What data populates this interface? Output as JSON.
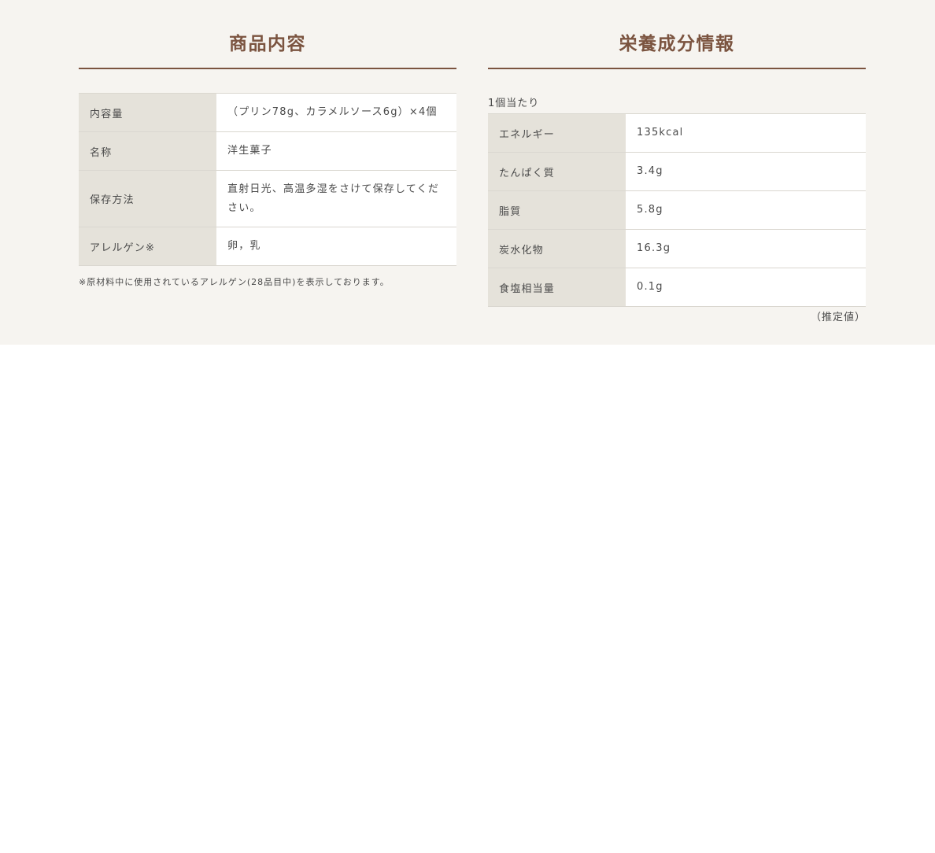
{
  "product": {
    "title": "商品内容",
    "rows": [
      {
        "label": "内容量",
        "value": "（プリン78g、カラメルソース6g）×4個"
      },
      {
        "label": "名称",
        "value": "洋生菓子"
      },
      {
        "label": "保存方法",
        "value": "直射日光、高温多湿をさけて保存してください。"
      },
      {
        "label": "アレルゲン※",
        "value": "卵，乳"
      }
    ],
    "note": "※原材料中に使用されているアレルゲン(28品目中)を表示しております。"
  },
  "nutrition": {
    "title": "栄養成分情報",
    "per_unit": "1個当たり",
    "rows": [
      {
        "label": "エネルギー",
        "value": "135kcal"
      },
      {
        "label": "たんぱく質",
        "value": "3.4g"
      },
      {
        "label": "脂質",
        "value": "5.8g"
      },
      {
        "label": "炭水化物",
        "value": "16.3g"
      },
      {
        "label": "食塩相当量",
        "value": "0.1g"
      }
    ],
    "estimate_note": "（推定値）"
  }
}
